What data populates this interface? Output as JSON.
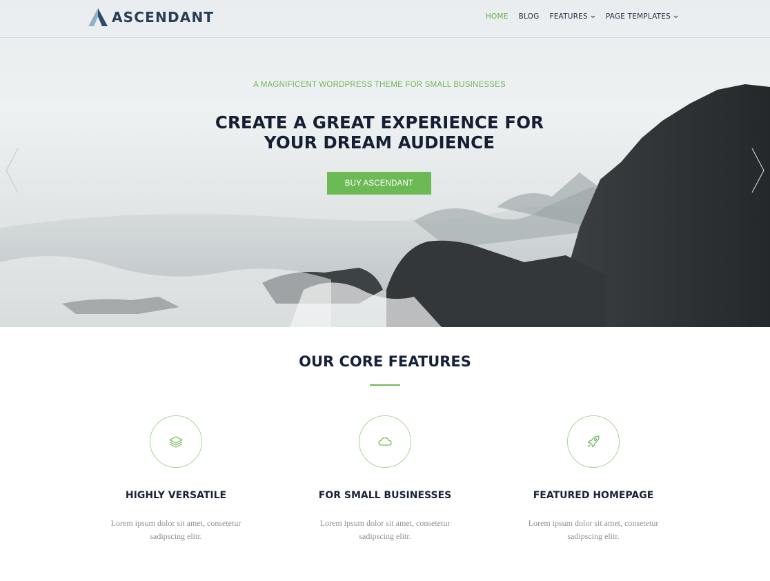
{
  "brand": {
    "name": "ASCENDANT"
  },
  "nav": {
    "items": [
      {
        "label": "HOME",
        "active": true,
        "dropdown": false
      },
      {
        "label": "BLOG",
        "active": false,
        "dropdown": false
      },
      {
        "label": "FEATURES",
        "active": false,
        "dropdown": true
      },
      {
        "label": "PAGE TEMPLATES",
        "active": false,
        "dropdown": true
      }
    ]
  },
  "hero": {
    "eyebrow": "A MAGNIFICENT WORDPRESS THEME FOR SMALL BUSINESSES",
    "title_line1": "CREATE A GREAT EXPERIENCE FOR",
    "title_line2": "YOUR DREAM AUDIENCE",
    "cta_label": "BUY ASCENDANT",
    "prev_icon": "chevron-left-icon",
    "next_icon": "chevron-right-icon"
  },
  "features": {
    "title": "OUR CORE FEATURES",
    "items": [
      {
        "icon": "layers-icon",
        "title": "HIGHLY VERSATILE",
        "text": "Lorem ipsum dolor sit amet, consetetur sadipscing elitr."
      },
      {
        "icon": "cloud-icon",
        "title": "FOR SMALL BUSINESSES",
        "text": "Lorem ipsum dolor sit amet, consetetur sadipscing elitr."
      },
      {
        "icon": "rocket-icon",
        "title": "FEATURED HOMEPAGE",
        "text": "Lorem ipsum dolor sit amet, consetetur sadipscing elitr."
      }
    ]
  },
  "colors": {
    "accent": "#6cba55",
    "heading": "#16213a",
    "body_text": "#8a8f96",
    "nav_text": "#243246"
  }
}
